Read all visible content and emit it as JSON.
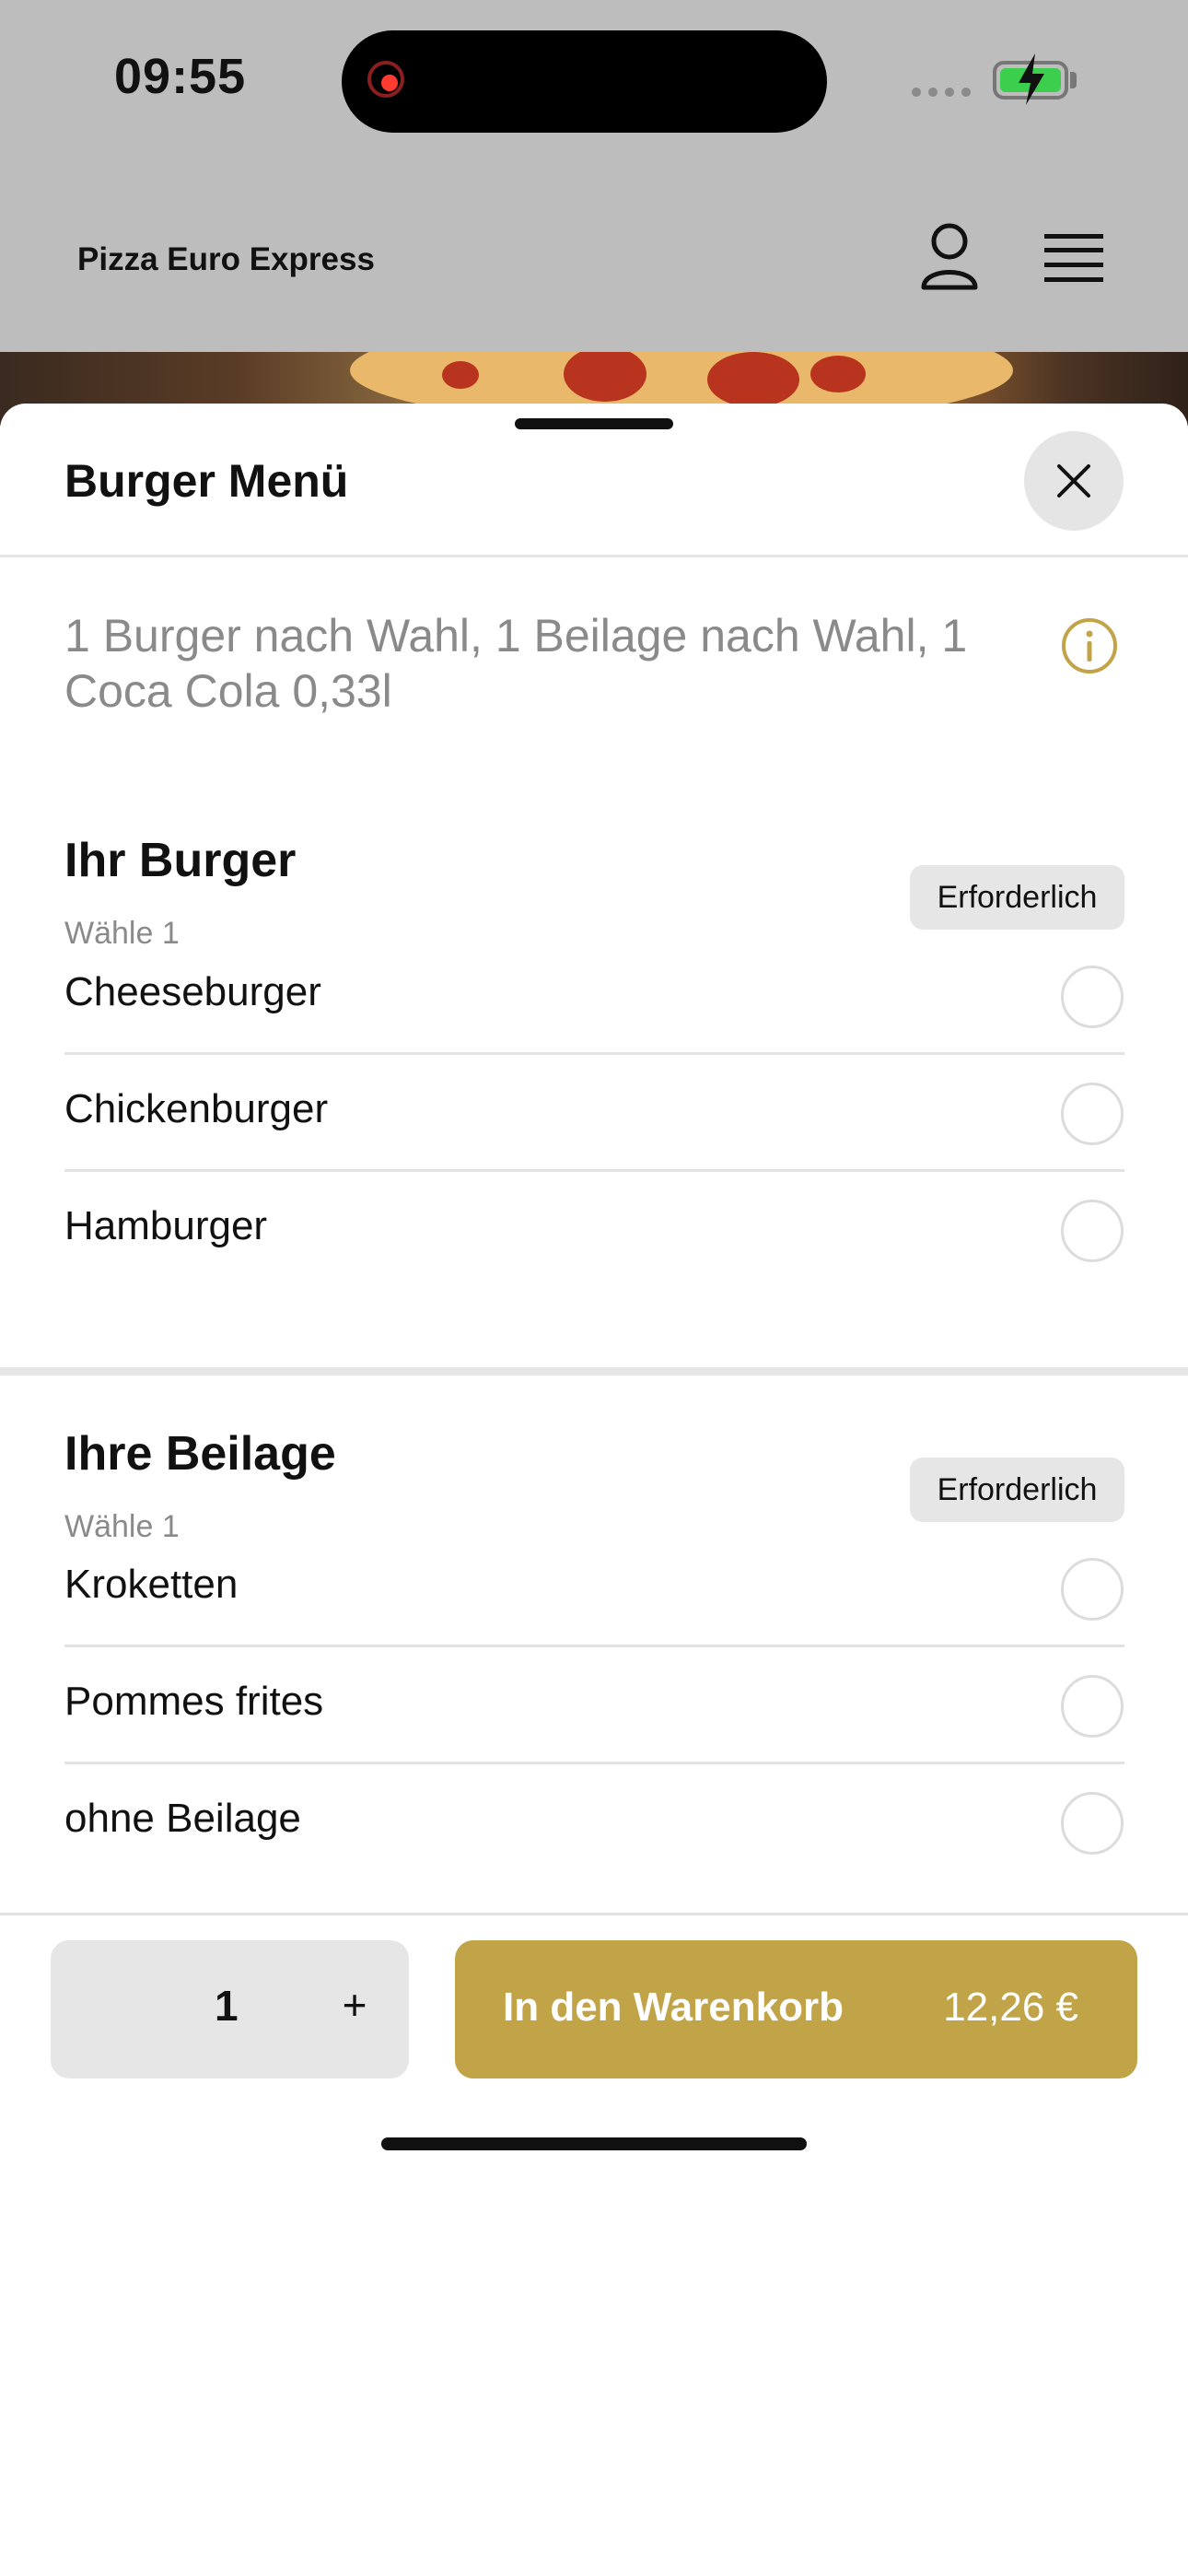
{
  "status_bar": {
    "time": "09:55"
  },
  "header": {
    "app_title": "Pizza Euro Express",
    "user_icon": "user-icon",
    "menu_icon": "hamburger-menu-icon"
  },
  "sheet": {
    "title": "Burger Menü",
    "close_icon": "close-icon",
    "description": "1 Burger nach Wahl, 1 Beilage nach Wahl, 1 Coca Cola 0,33l",
    "info_icon": "info-icon",
    "accent_color": "#c1a348"
  },
  "sections": [
    {
      "title": "Ihr Burger",
      "subtitle": "Wähle 1",
      "badge": "Erforderlich",
      "options": [
        {
          "label": "Cheeseburger",
          "selected": false
        },
        {
          "label": "Chickenburger",
          "selected": false
        },
        {
          "label": "Hamburger",
          "selected": false
        }
      ]
    },
    {
      "title": "Ihre Beilage",
      "subtitle": "Wähle 1",
      "badge": "Erforderlich",
      "options": [
        {
          "label": "Kroketten",
          "selected": false
        },
        {
          "label": "Pommes frites",
          "selected": false
        },
        {
          "label": "ohne Beilage",
          "selected": false
        }
      ]
    }
  ],
  "footer": {
    "quantity": "1",
    "plus_label": "+",
    "add_to_cart_label": "In den Warenkorb",
    "price": "12,26 €"
  }
}
